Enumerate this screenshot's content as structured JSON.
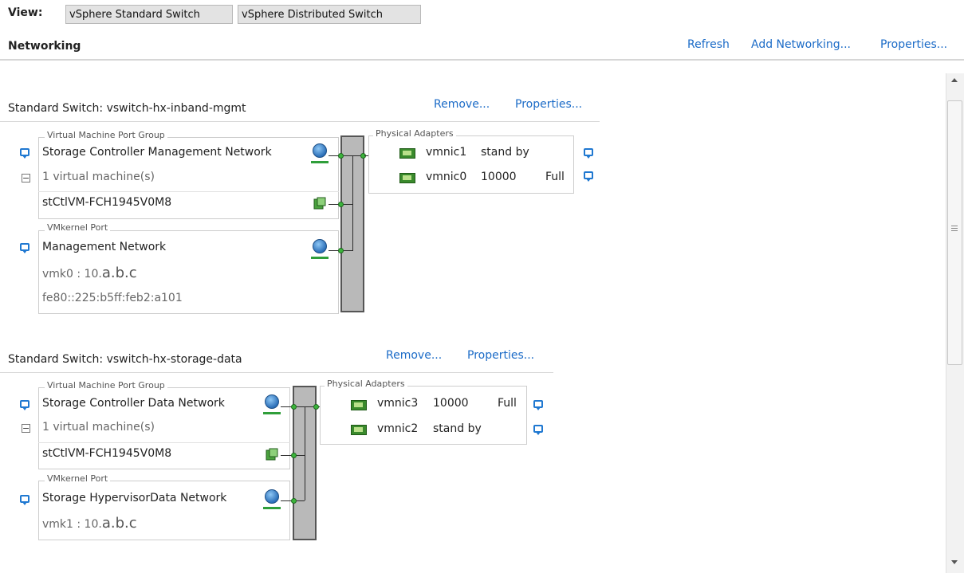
{
  "view": {
    "label": "View:",
    "buttons": [
      "vSphere Standard Switch",
      "vSphere Distributed Switch"
    ]
  },
  "section": {
    "title": "Networking",
    "links": [
      "Refresh",
      "Add Networking...",
      "Properties..."
    ]
  },
  "switches": [
    {
      "title": "Standard Switch: vswitch-hx-inband-mgmt",
      "remove": "Remove...",
      "properties": "Properties...",
      "vm_group_legend": "Virtual Machine Port Group",
      "vm_group_name": "Storage Controller Management Network",
      "vm_count": "1 virtual machine(s)",
      "vm_name": "stCtlVM-FCH1945V0M8",
      "vmk_legend": "VMkernel Port",
      "vmk_name": "Management Network",
      "vmk_ip_prefix": "vmk0 : 10.",
      "vmk_ip_suffix": "a.b.c",
      "vmk_ipv6": "fe80::225:b5ff:feb2:a101",
      "adapters_legend": "Physical Adapters",
      "adapters": [
        {
          "name": "vmnic1",
          "speed": "stand by",
          "duplex": ""
        },
        {
          "name": "vmnic0",
          "speed": "10000",
          "duplex": "Full"
        }
      ]
    },
    {
      "title": "Standard Switch: vswitch-hx-storage-data",
      "remove": "Remove...",
      "properties": "Properties...",
      "vm_group_legend": "Virtual Machine Port Group",
      "vm_group_name": "Storage Controller Data Network",
      "vm_count": "1 virtual machine(s)",
      "vm_name": "stCtlVM-FCH1945V0M8",
      "vmk_legend": "VMkernel Port",
      "vmk_name": "Storage HypervisorData Network",
      "vmk_ip_prefix": "vmk1 : 10.",
      "vmk_ip_suffix": "a.b.c",
      "adapters_legend": "Physical Adapters",
      "adapters": [
        {
          "name": "vmnic3",
          "speed": "10000",
          "duplex": "Full"
        },
        {
          "name": "vmnic2",
          "speed": "stand by",
          "duplex": ""
        }
      ]
    }
  ],
  "colors": {
    "link": "#1b6bc7",
    "info_icon": "#1f78d1",
    "nic": "#3a8a2c",
    "port_dot": "#3cb43c"
  }
}
